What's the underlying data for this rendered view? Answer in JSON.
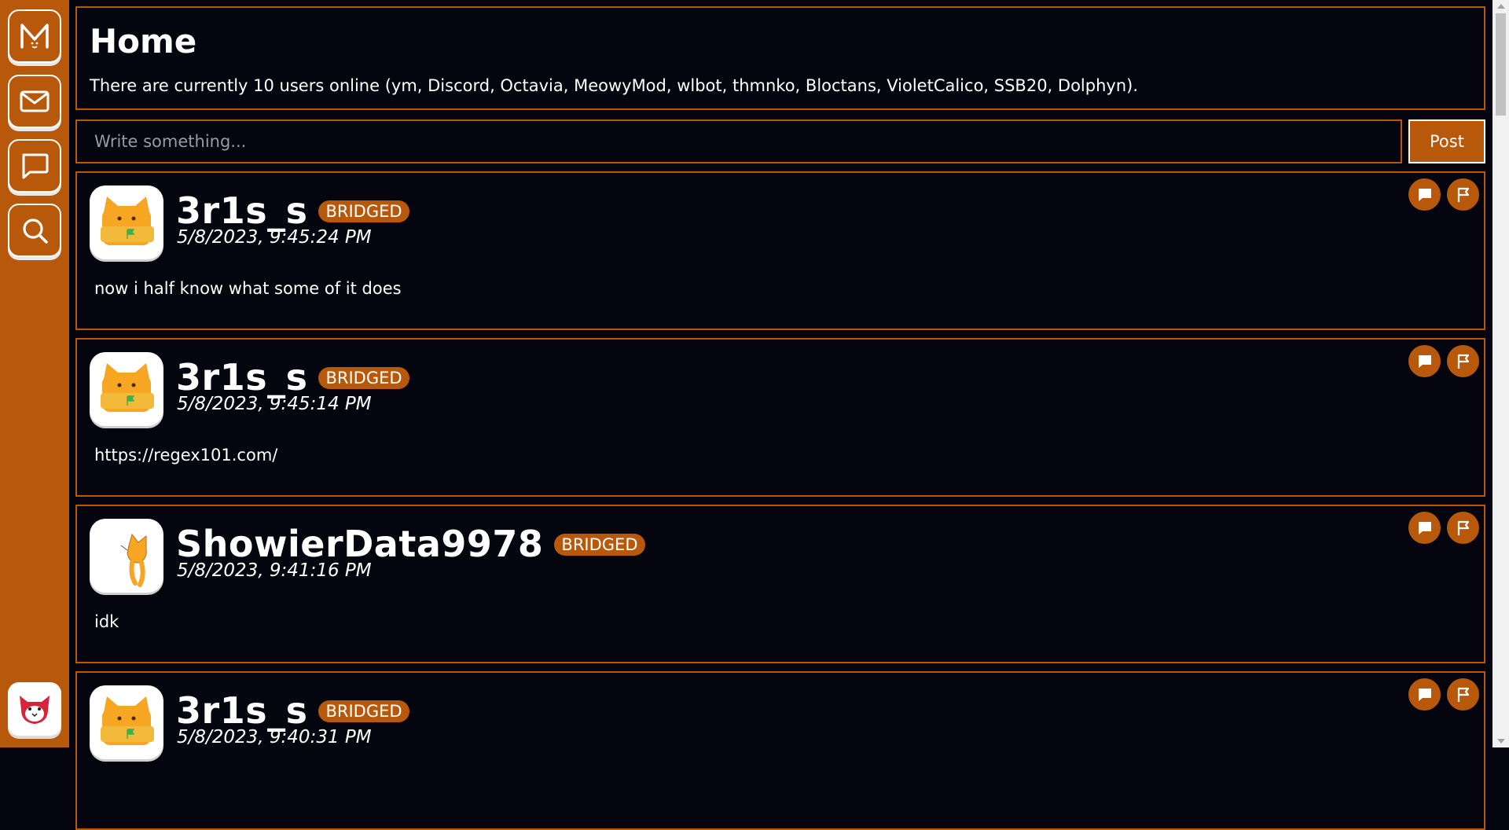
{
  "colors": {
    "accent": "#b8580b",
    "background": "#05050f",
    "text": "#ffffff"
  },
  "sidebar": {
    "items": [
      {
        "name": "logo",
        "icon": "meower-logo-icon"
      },
      {
        "name": "inbox",
        "icon": "mail-icon"
      },
      {
        "name": "chats",
        "icon": "chat-bubble-icon"
      },
      {
        "name": "search",
        "icon": "search-icon"
      }
    ],
    "profile_icon": "profile-avatar-icon"
  },
  "home": {
    "title": "Home",
    "online_text": "There are currently 10 users online (ym, Discord, Octavia, MeowyMod, wlbot, thmnko, Bloctans, VioletCalico, SSB20, Dolphyn)."
  },
  "compose": {
    "placeholder": "Write something...",
    "post_label": "Post"
  },
  "posts": [
    {
      "user": "3r1s_s",
      "badge": "BRIDGED",
      "date": "5/8/2023, 9:45:24 PM",
      "text": "now i half know what some of it does"
    },
    {
      "user": "3r1s_s",
      "badge": "BRIDGED",
      "date": "5/8/2023, 9:45:14 PM",
      "text": "https://regex101.com/"
    },
    {
      "user": "ShowierData9978",
      "badge": "BRIDGED",
      "date": "5/8/2023, 9:41:16 PM",
      "text": "idk"
    },
    {
      "user": "3r1s_s",
      "badge": "BRIDGED",
      "date": "5/8/2023, 9:40:31 PM",
      "text": ""
    }
  ]
}
